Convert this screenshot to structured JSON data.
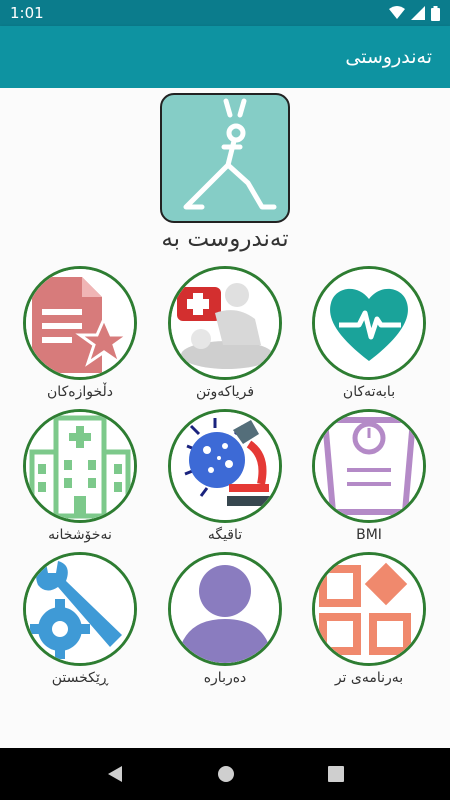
{
  "status_bar": {
    "time": "1:01",
    "icons": [
      "wifi-icon",
      "signal-icon",
      "battery-icon"
    ]
  },
  "app_bar": {
    "title": "تەندروستی"
  },
  "hero": {
    "title": "تەندروست بە",
    "icon": "yoga-pose-icon"
  },
  "tiles": [
    {
      "label": "بابەتەکان",
      "icon": "heart-pulse-icon"
    },
    {
      "label": "فریاکەوتن",
      "icon": "first-aid-icon"
    },
    {
      "label": "دڵخوازەکان",
      "icon": "favorites-document-icon"
    },
    {
      "label": "BMI",
      "icon": "scale-icon"
    },
    {
      "label": "تاقیگە",
      "icon": "lab-microscope-icon"
    },
    {
      "label": "نەخۆشخانە",
      "icon": "hospital-icon"
    },
    {
      "label": "بەرنامەی تر",
      "icon": "other-apps-icon"
    },
    {
      "label": "دەربارە",
      "icon": "about-user-icon"
    },
    {
      "label": "ڕێکخستن",
      "icon": "settings-tools-icon"
    }
  ],
  "colors": {
    "status_bar": "#0b7c8c",
    "app_bar": "#0e93a1",
    "circle_border": "#2e7d32"
  }
}
